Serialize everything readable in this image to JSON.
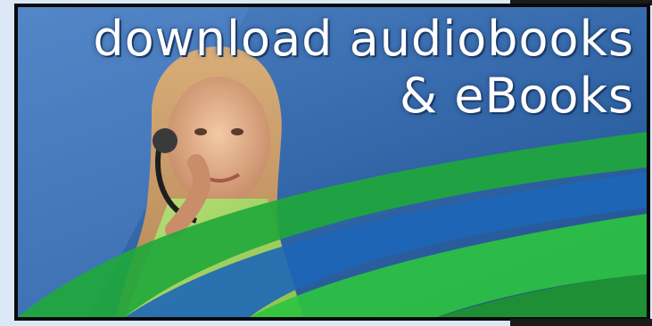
{
  "banner": {
    "headline_line1": "download audiobooks",
    "headline_line2": "& eBooks",
    "colors": {
      "sky_blue": "#3b6fb1",
      "green_band": "#1fa83a",
      "light_green_band": "#2cc43f",
      "blue_band": "#1d66b8",
      "text": "#ffffff"
    },
    "figure": "woman-with-headset-photo"
  }
}
